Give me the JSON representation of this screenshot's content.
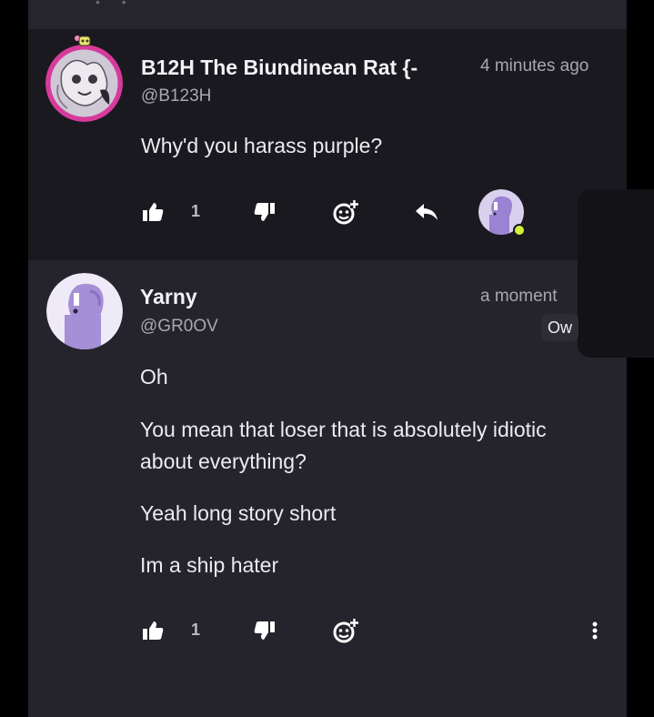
{
  "comments": [
    {
      "name": "B12H The Biundinean Rat {-",
      "handle": "@B123H",
      "time": "4 minutes ago",
      "text": [
        "Why'd you harass purple?"
      ],
      "like_count": "1"
    },
    {
      "name": "Yarny",
      "handle": "@GR0OV",
      "time": "a moment",
      "text": [
        "Oh",
        "You mean that loser that is absolutely idiotic about everything?",
        "Yeah long story short",
        "Im a ship hater"
      ],
      "like_count": "1"
    }
  ],
  "popup": {
    "button_label": "Ow"
  },
  "icons": {
    "like": "thumbs-up-icon",
    "dislike": "thumbs-down-icon",
    "reaction": "add-reaction-icon",
    "reply": "reply-arrow-icon",
    "more": "more-vertical-icon"
  },
  "colors": {
    "background": "#000000",
    "panel": "#211f27",
    "comment_highlight": "#1a191f",
    "text": "#ecebf0",
    "muted": "#a9a6b2",
    "avatar_purple": "#a58fd6",
    "online": "#d4f03c"
  }
}
